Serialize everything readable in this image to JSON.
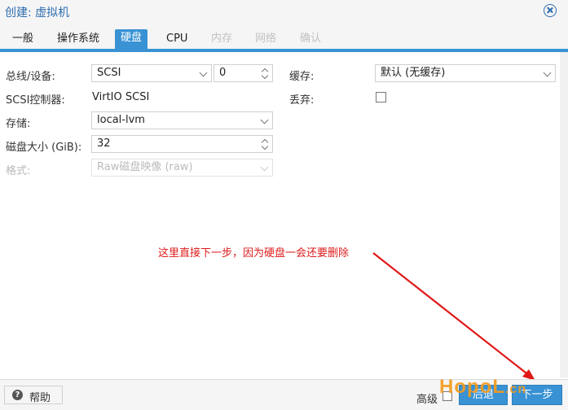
{
  "window": {
    "title": "创建: 虚拟机"
  },
  "tabs": [
    {
      "label": "一般",
      "state": "normal"
    },
    {
      "label": "操作系统",
      "state": "normal"
    },
    {
      "label": "硬盘",
      "state": "active"
    },
    {
      "label": "CPU",
      "state": "normal"
    },
    {
      "label": "内存",
      "state": "disabled"
    },
    {
      "label": "网络",
      "state": "disabled"
    },
    {
      "label": "确认",
      "state": "disabled"
    }
  ],
  "form": {
    "bus_label": "总线/设备:",
    "bus_value": "SCSI",
    "device_value": "0",
    "controller_label": "SCSI控制器:",
    "controller_value": "VirtIO SCSI",
    "storage_label": "存储:",
    "storage_value": "local-lvm",
    "size_label": "磁盘大小 (GiB):",
    "size_value": "32",
    "format_label": "格式:",
    "format_value": "Raw磁盘映像 (raw)",
    "cache_label": "缓存:",
    "cache_value": "默认 (无缓存)",
    "discard_label": "丢弃:"
  },
  "annotation": {
    "text": "这里直接下一步，因为硬盘一会还要删除"
  },
  "footer": {
    "help_label": "帮助",
    "advanced_label": "高级",
    "back_label": "后退",
    "next_label": "下一步"
  },
  "watermark": {
    "text_main": "HopoL",
    "text_small": ".cn"
  },
  "colors": {
    "accent": "#3892d4",
    "annotation": "#dd1c1c",
    "watermark": "#f39b1e"
  }
}
